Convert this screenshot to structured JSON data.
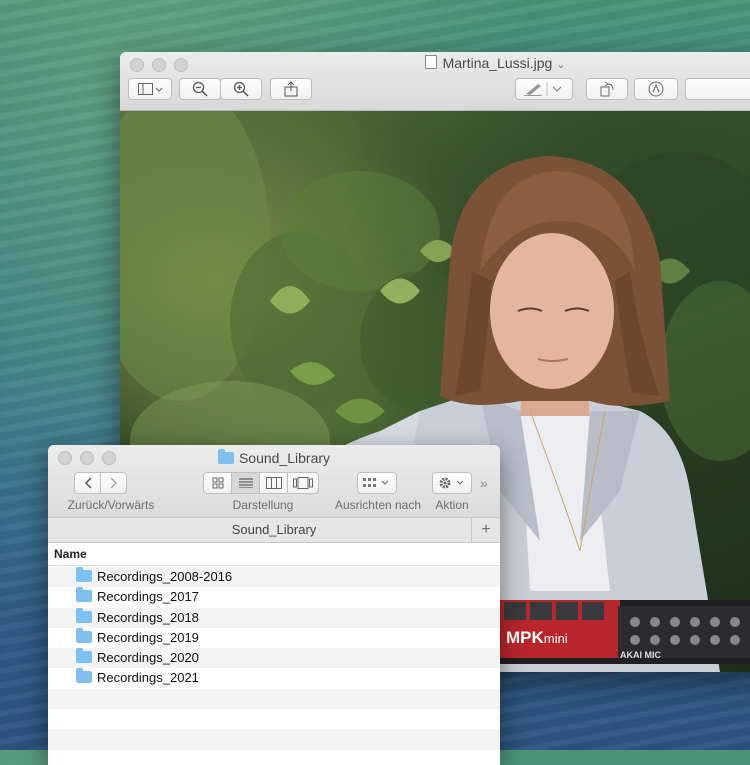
{
  "preview": {
    "title": "Martina_Lussi.jpg",
    "title_chevron": "⌄"
  },
  "finder": {
    "title": "Sound_Library",
    "labels": {
      "nav": "Zurück/Vorwärts",
      "view": "Darstellung",
      "arrange": "Ausrichten nach",
      "action": "Aktion"
    },
    "path": "Sound_Library",
    "column_header": "Name",
    "items": [
      "Recordings_2008-2016",
      "Recordings_2017",
      "Recordings_2018",
      "Recordings_2019",
      "Recordings_2020",
      "Recordings_2021"
    ]
  },
  "keyboard": {
    "brand": "MPK",
    "model": "mini",
    "maker": "AKAI",
    "maker_suffix": "MIC"
  },
  "colors": {
    "folder": "#7ec0ef",
    "keyboard_red": "#b8262b"
  }
}
